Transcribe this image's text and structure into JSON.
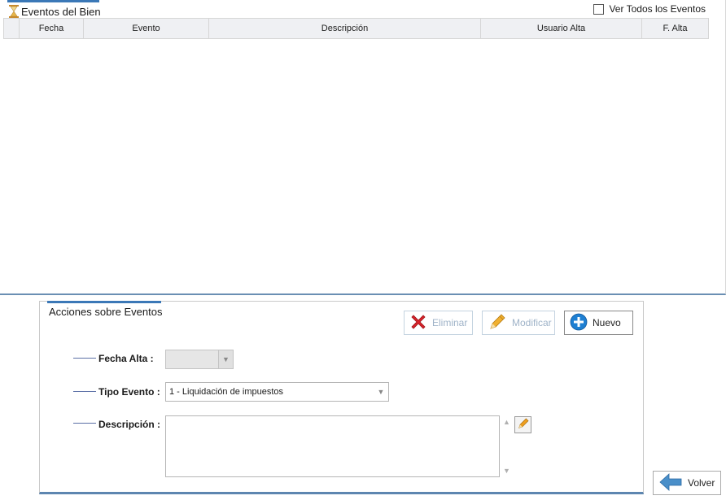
{
  "top_panel": {
    "title": "Eventos del Bien",
    "ver_todos_label": "Ver Todos los Eventos",
    "ver_todos_checked": false,
    "columns": [
      "",
      "Fecha",
      "Evento",
      "Descripción",
      "Usuario Alta",
      "F. Alta"
    ],
    "rows": []
  },
  "actions": {
    "title": "Acciones sobre Eventos",
    "buttons": {
      "eliminar": "Eliminar",
      "modificar": "Modificar",
      "nuevo": "Nuevo"
    },
    "fields": {
      "fecha_alta_label": "Fecha Alta :",
      "fecha_alta_value": "",
      "tipo_evento_label": "Tipo Evento :",
      "tipo_evento_value": "1 - Liquidación de impuestos",
      "descripcion_label": "Descripción :",
      "descripcion_value": ""
    }
  },
  "volver_label": "Volver",
  "colors": {
    "accent": "#3b78b7",
    "eliminar_icon": "#d8222a",
    "nuevo_icon": "#1e7fd2",
    "volver_arrow": "#4a8fc9",
    "pencil": "#f0a020"
  }
}
